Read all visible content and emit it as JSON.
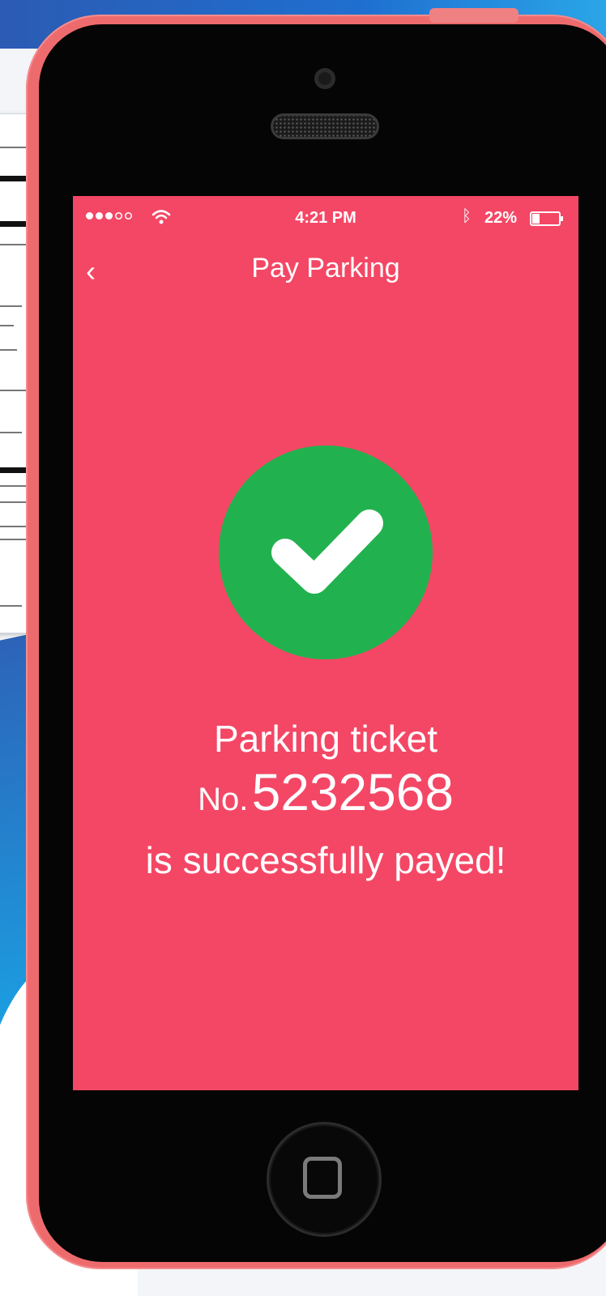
{
  "status_bar": {
    "time": "4:21 PM",
    "battery_percent": "22%",
    "battery_level": 0.22,
    "signal_bars_filled": 3,
    "signal_bars_total": 5
  },
  "nav": {
    "back_symbol": "‹",
    "title": "Pay Parking"
  },
  "icons": {
    "success": "checkmark-icon",
    "back": "chevron-left-icon",
    "wifi": "wifi-icon",
    "bluetooth": "bluetooth-icon",
    "battery": "battery-icon",
    "home": "home-button-icon"
  },
  "message": {
    "line1": "Parking ticket",
    "no_label": "No.",
    "ticket_number": "5232568",
    "line3": "is successfully payed!"
  },
  "colors": {
    "screen_bg": "#f44765",
    "success_green": "#22b14f",
    "phone_case": "#ee6b6d"
  }
}
